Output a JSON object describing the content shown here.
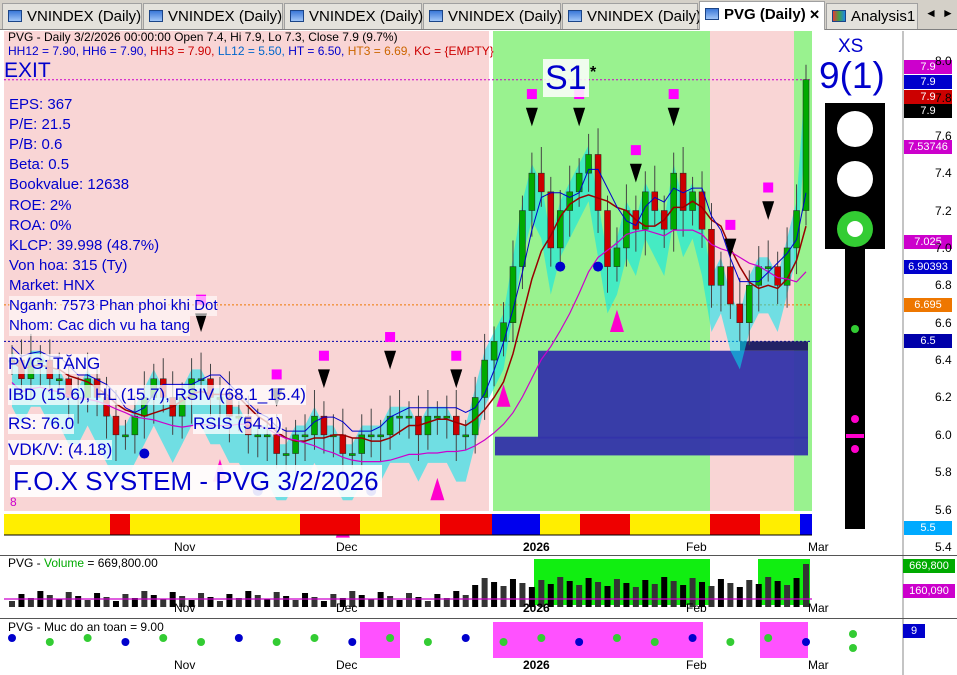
{
  "tabs": [
    {
      "label": "VNINDEX (Daily)",
      "active": false
    },
    {
      "label": "VNINDEX (Daily)",
      "active": false
    },
    {
      "label": "VNINDEX (Daily)",
      "active": false
    },
    {
      "label": "VNINDEX (Daily)",
      "active": false
    },
    {
      "label": "VNINDEX (Daily)",
      "active": false
    },
    {
      "label": "PVG (Daily)",
      "active": true
    },
    {
      "label": "Analysis1",
      "active": false
    }
  ],
  "tab_close": "✕",
  "nav_prev": "◄",
  "nav_next": "►",
  "chart": {
    "header_line": "PVG - Daily 3/2/2026 00:00:00 Open 7.4, Hi 7.9, Lo 7.3, Close 7.9 (9.7%)",
    "indicators": [
      {
        "text": "HH12 = 7.90, ",
        "color": "#0000cc"
      },
      {
        "text": "HH6 = 7.90, ",
        "color": "#0000cc"
      },
      {
        "text": "HH3 = 7.90, ",
        "color": "#cc0000"
      },
      {
        "text": "LL12 = 5.50, ",
        "color": "#0066cc"
      },
      {
        "text": "HT = 6.50, ",
        "color": "#0000cc"
      },
      {
        "text": "HT3 = 6.69, ",
        "color": "#cc6600"
      },
      {
        "text": "KC = {EMPTY}",
        "color": "#cc0000"
      }
    ],
    "exit_label": "EXIT",
    "signal_label": "S1",
    "signal_star": "*",
    "fundamentals": [
      "EPS: 367",
      "P/E: 21.5",
      "P/B: 0.6",
      "Beta: 0.5",
      "Bookvalue: 12638",
      "ROE: 2%",
      "ROA: 0%",
      "KLCP: 39.998 (48.7%)",
      "Von hoa: 315 (Ty)",
      "Market: HNX",
      "Nganh: 7573 Phan phoi khi Dot",
      "Nhom: Cac dich vu ha tang"
    ],
    "trend_label": "PVG: TĂNG",
    "ibd_label": "IBD (15.6), HL (15.7), RSIV (68.1_15.4)",
    "rs_label": "RS: 76.0",
    "rsis_label": "RSIS (54.1)",
    "vdk_label": "VDK/V:  (4.18)",
    "system_label": "F.O.X SYSTEM - PVG 3/2/2026",
    "small_8": "8",
    "xs_label": "XS",
    "xs_value": "9(1)",
    "price_labels": [
      {
        "text": "7.9",
        "price": 7.97,
        "bg": "#cc00cc"
      },
      {
        "text": "7.9",
        "price": 7.89,
        "bg": "#0000cc"
      },
      {
        "text": "7.9",
        "price": 7.81,
        "bg": "#cc0000"
      },
      {
        "text": "7.9",
        "price": 7.73,
        "bg": "#000000"
      },
      {
        "text": "7.53746",
        "price": 7.54,
        "bg": "#cc00cc"
      },
      {
        "text": "7.025",
        "price": 7.03,
        "bg": "#cc00cc"
      },
      {
        "text": "6.90393",
        "price": 6.9,
        "bg": "#0000cc"
      },
      {
        "text": "6.695",
        "price": 6.695,
        "bg": "#ee7700"
      },
      {
        "text": "6.5",
        "price": 6.5,
        "bg": "#0000aa"
      },
      {
        "text": "5.5",
        "price": 5.5,
        "bg": "#00aaff"
      }
    ],
    "price_ticks": [
      "8.0",
      "7.8",
      "7.6",
      "7.4",
      "7.2",
      "7.0",
      "6.8",
      "6.6",
      "6.4",
      "6.2",
      "6.0",
      "5.8",
      "5.6",
      "5.4"
    ],
    "x_labels": [
      "Nov",
      "Dec",
      "2026",
      "Feb",
      "Mar"
    ],
    "volume_title_prefix": "PVG - ",
    "volume_title_name": "Volume",
    "volume_title_value": " = 669,800.00",
    "volume_labels": [
      {
        "text": "669,800",
        "bg": "#00aa00"
      },
      {
        "text": "160,090",
        "bg": "#cc00cc"
      }
    ],
    "safety_title": "PVG - Muc do an toan = 9.00",
    "safety_label": "9"
  },
  "colors": {
    "pink_zone": "#f9d5d5",
    "green_zone": "#99f28f",
    "blue_box": "#3333aa",
    "up_candle": "#00aa00",
    "down_candle": "#cc0000",
    "cyan_band": "#00e5ee",
    "signal_green": "#33cc33"
  },
  "chart_data": {
    "type": "candlestick",
    "symbol": "PVG",
    "interval": "Daily",
    "last": {
      "date": "3/2/2026",
      "open": 7.4,
      "high": 7.9,
      "low": 7.3,
      "close": 7.9,
      "change_pct": 9.7
    },
    "ylim": [
      5.4,
      8.0
    ],
    "levels": {
      "HH12": 7.9,
      "HH6": 7.9,
      "HH3": 7.9,
      "LL12": 5.5,
      "HT": 6.5,
      "HT3": 6.69
    },
    "closes": [
      6.4,
      6.3,
      6.4,
      6.4,
      6.3,
      6.3,
      6.2,
      6.2,
      6.3,
      6.2,
      6.1,
      6.0,
      6.0,
      6.1,
      6.2,
      6.3,
      6.2,
      6.1,
      6.2,
      6.3,
      6.3,
      6.2,
      6.2,
      6.1,
      6.1,
      6.0,
      6.0,
      6.0,
      5.9,
      5.9,
      6.0,
      6.0,
      6.1,
      6.0,
      6.0,
      5.9,
      5.9,
      6.0,
      6.0,
      6.0,
      6.1,
      6.1,
      6.1,
      6.0,
      6.1,
      6.1,
      6.1,
      6.0,
      6.0,
      6.2,
      6.4,
      6.5,
      6.6,
      6.9,
      7.2,
      7.4,
      7.3,
      7.0,
      7.2,
      7.3,
      7.4,
      7.5,
      7.2,
      6.9,
      7.0,
      7.2,
      7.1,
      7.3,
      7.2,
      7.1,
      7.4,
      7.2,
      7.3,
      7.1,
      6.8,
      6.9,
      6.7,
      6.6,
      6.8,
      6.9,
      6.9,
      6.8,
      7.0,
      7.2,
      7.9
    ],
    "volume_last": 669800,
    "volume_ma": 160090,
    "safety_level": 9
  }
}
